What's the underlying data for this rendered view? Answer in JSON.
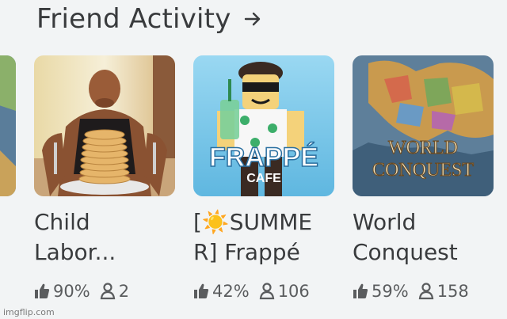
{
  "section": {
    "title": "Friend Activity"
  },
  "cards": [
    {
      "title": "Child\nLabor...",
      "like_ratio": "90%",
      "players": "2"
    },
    {
      "title": "[☀️SUMME\nR] Frappé",
      "like_ratio": "42%",
      "players": "106"
    },
    {
      "title": "World\nConquest",
      "like_ratio": "59%",
      "players": "158"
    }
  ],
  "thumbnail_text": {
    "cafe_brand": "FRAPPÉ",
    "cafe_sub": "CAFE",
    "conquest_line1": "WORLD",
    "conquest_line2": "CONQUEST"
  },
  "watermark": "imgflip.com"
}
